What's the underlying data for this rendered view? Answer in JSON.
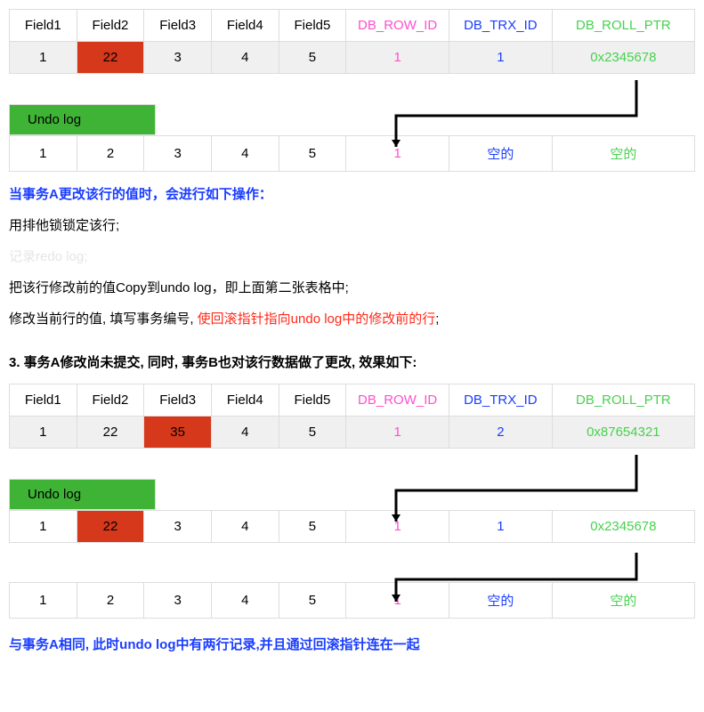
{
  "tables": {
    "headers": {
      "f1": "Field1",
      "f2": "Field2",
      "f3": "Field3",
      "f4": "Field4",
      "f5": "Field5",
      "row_id": "DB_ROW_ID",
      "trx_id": "DB_TRX_ID",
      "roll_ptr": "DB_ROLL_PTR"
    },
    "t1": {
      "f1": "1",
      "f2": "22",
      "f3": "3",
      "f4": "4",
      "f5": "5",
      "row_id": "1",
      "trx_id": "1",
      "roll_ptr": "0x2345678"
    },
    "undo1": {
      "f1": "1",
      "f2": "2",
      "f3": "3",
      "f4": "4",
      "f5": "5",
      "row_id": "1",
      "trx_id": "空的",
      "roll_ptr": "空的"
    },
    "t2": {
      "f1": "1",
      "f2": "22",
      "f3": "35",
      "f4": "4",
      "f5": "5",
      "row_id": "1",
      "trx_id": "2",
      "roll_ptr": "0x87654321"
    },
    "undo2a": {
      "f1": "1",
      "f2": "22",
      "f3": "3",
      "f4": "4",
      "f5": "5",
      "row_id": "1",
      "trx_id": "1",
      "roll_ptr": "0x2345678"
    },
    "undo2b": {
      "f1": "1",
      "f2": "2",
      "f3": "3",
      "f4": "4",
      "f5": "5",
      "row_id": "1",
      "trx_id": "空的",
      "roll_ptr": "空的"
    }
  },
  "undo_label": "Undo log",
  "steps": {
    "head": "当事务A更改该行的值时，会进行如下操作：",
    "s1": "用排他锁锁定该行;",
    "s2": "记录redo log;",
    "s3": "把该行修改前的值Copy到undo log，即上面第二张表格中;",
    "s4_a": "修改当前行的值, 填写事务编号, ",
    "s4_b": "使回滚指针指向undo log中的修改前的行",
    "s4_c": ";"
  },
  "section3": "3. 事务A修改尚未提交, 同时, 事务B也对该行数据做了更改, 效果如下:",
  "footer": "与事务A相同, 此时undo log中有两行记录,并且通过回滚指针连在一起"
}
